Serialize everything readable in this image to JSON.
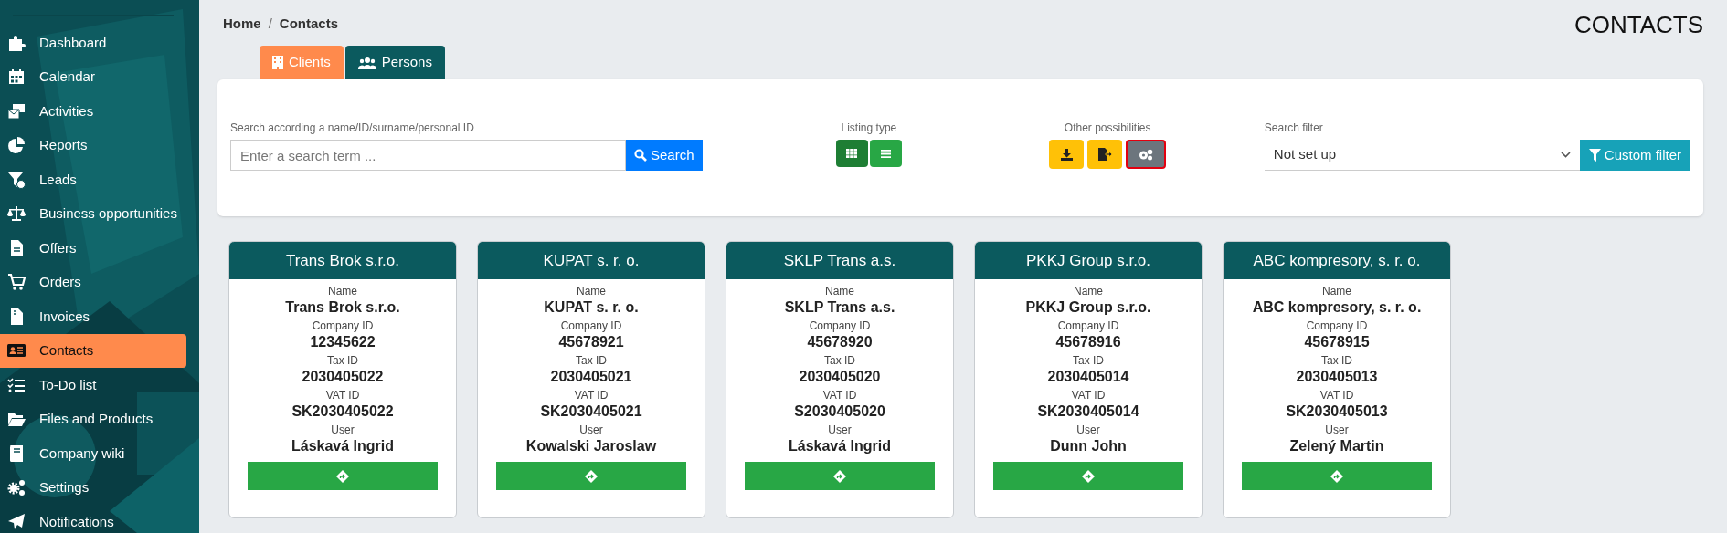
{
  "sidebar": {
    "items": [
      {
        "label": "Dashboard",
        "selected": false
      },
      {
        "label": "Calendar",
        "selected": false
      },
      {
        "label": "Activities",
        "selected": false
      },
      {
        "label": "Reports",
        "selected": false
      },
      {
        "label": "Leads",
        "selected": false
      },
      {
        "label": "Business opportunities",
        "selected": false
      },
      {
        "label": "Offers",
        "selected": false
      },
      {
        "label": "Orders",
        "selected": false
      },
      {
        "label": "Invoices",
        "selected": false
      },
      {
        "label": "Contacts",
        "selected": true
      },
      {
        "label": "To-Do list",
        "selected": false
      },
      {
        "label": "Files and Products",
        "selected": false
      },
      {
        "label": "Company wiki",
        "selected": false
      },
      {
        "label": "Settings",
        "selected": false
      },
      {
        "label": "Notifications",
        "selected": false
      }
    ]
  },
  "breadcrumb": {
    "items": [
      "Home",
      "Contacts"
    ],
    "separator": "/"
  },
  "page_title": "CONTACTS",
  "tabs": [
    {
      "label": "Clients",
      "selected": true
    },
    {
      "label": "Persons",
      "selected": false
    }
  ],
  "search": {
    "label": "Search according a name/ID/surname/personal ID",
    "placeholder": "Enter a search term ...",
    "button": "Search"
  },
  "listing_type": {
    "label": "Listing type",
    "options": [
      {
        "kind": "grid",
        "selected": true
      },
      {
        "kind": "list",
        "selected": false
      }
    ]
  },
  "other_possibilities": {
    "label": "Other possibilities",
    "buttons": [
      {
        "kind": "download",
        "focused": false
      },
      {
        "kind": "export",
        "focused": false
      },
      {
        "kind": "settings",
        "focused": true
      }
    ]
  },
  "search_filter": {
    "label": "Search filter",
    "value": "Not set up",
    "button": "Custom filter"
  },
  "cards": [
    {
      "title": "Trans Brok s.r.o.",
      "fields": [
        {
          "label": "Name",
          "value": "Trans Brok s.r.o."
        },
        {
          "label": "Company ID",
          "value": "12345622"
        },
        {
          "label": "Tax ID",
          "value": "2030405022"
        },
        {
          "label": "VAT ID",
          "value": "SK2030405022"
        },
        {
          "label": "User",
          "value": "Láskavá Ingrid"
        }
      ]
    },
    {
      "title": "KUPAT s. r. o.",
      "fields": [
        {
          "label": "Name",
          "value": "KUPAT s. r. o."
        },
        {
          "label": "Company ID",
          "value": "45678921"
        },
        {
          "label": "Tax ID",
          "value": "2030405021"
        },
        {
          "label": "VAT ID",
          "value": "SK2030405021"
        },
        {
          "label": "User",
          "value": "Kowalski Jaroslaw"
        }
      ]
    },
    {
      "title": "SKLP Trans a.s.",
      "fields": [
        {
          "label": "Name",
          "value": "SKLP Trans a.s."
        },
        {
          "label": "Company ID",
          "value": "45678920"
        },
        {
          "label": "Tax ID",
          "value": "2030405020"
        },
        {
          "label": "VAT ID",
          "value": "S2030405020"
        },
        {
          "label": "User",
          "value": "Láskavá Ingrid"
        }
      ]
    },
    {
      "title": "PKKJ Group s.r.o.",
      "fields": [
        {
          "label": "Name",
          "value": "PKKJ Group s.r.o."
        },
        {
          "label": "Company ID",
          "value": "45678916"
        },
        {
          "label": "Tax ID",
          "value": "2030405014"
        },
        {
          "label": "VAT ID",
          "value": "SK2030405014"
        },
        {
          "label": "User",
          "value": "Dunn John"
        }
      ]
    },
    {
      "title": "ABC kompresory, s. r. o.",
      "fields": [
        {
          "label": "Name",
          "value": "ABC kompresory, s. r. o."
        },
        {
          "label": "Company ID",
          "value": "45678915"
        },
        {
          "label": "Tax ID",
          "value": "2030405013"
        },
        {
          "label": "VAT ID",
          "value": "SK2030405013"
        },
        {
          "label": "User",
          "value": "Zelený Martin"
        }
      ]
    }
  ]
}
